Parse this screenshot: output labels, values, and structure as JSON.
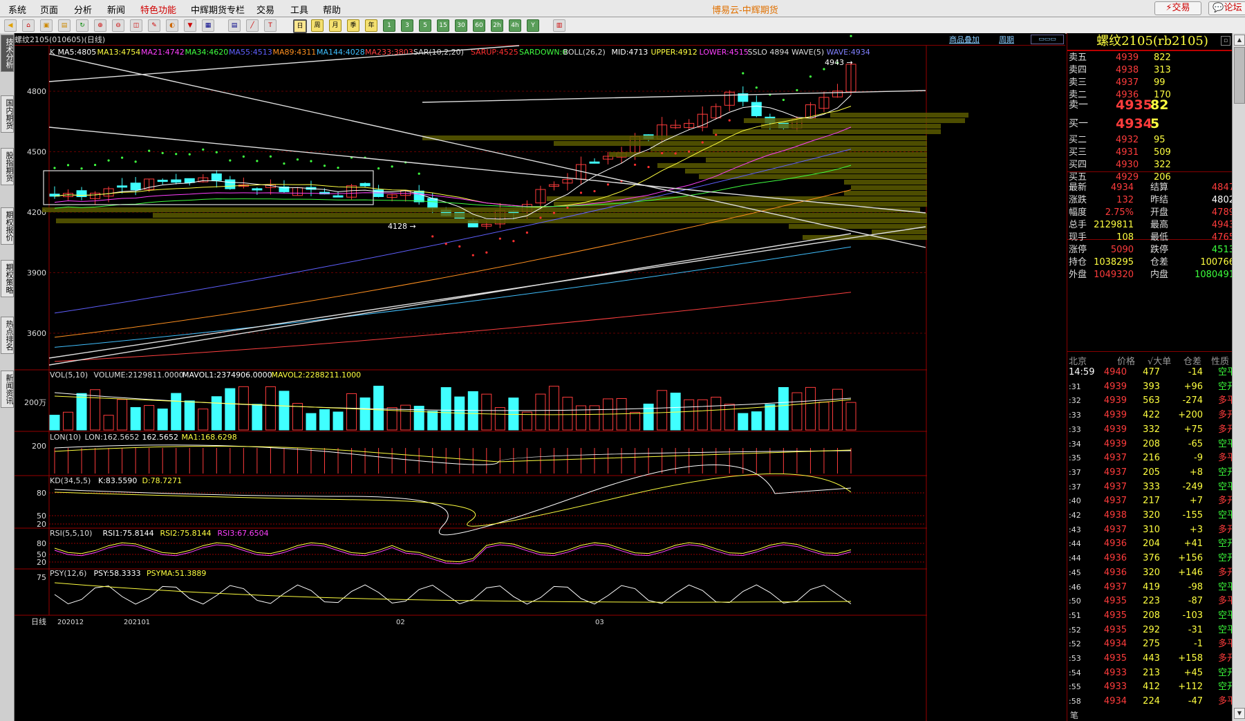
{
  "menu": {
    "items": [
      "系统",
      "页面",
      "分析",
      "新闻",
      "特色功能",
      "中辉期货专栏",
      "交易",
      "工具",
      "帮助"
    ],
    "title": "博易云-中辉期货",
    "trade_btn": "⚡交易",
    "forum_btn": "💬论坛"
  },
  "toolbar": {
    "periods": [
      "日",
      "周",
      "月",
      "季",
      "年"
    ],
    "minutes": [
      "1",
      "3",
      "5",
      "15",
      "30",
      "60",
      "2h",
      "4h",
      "Y"
    ]
  },
  "leftnav": [
    "技术分析",
    "国内期货",
    "股指期货",
    "期权报价",
    "期权策略",
    "热点排名",
    "新闻资讯"
  ],
  "chart": {
    "header_title": "螺纹2105(010605)(日线)",
    "header_link1": "商品叠加",
    "header_link2": "周期",
    "ma_line": [
      {
        "text": "K",
        "color": "#dddddd"
      },
      {
        "text": "MA5:4805",
        "color": "#ffffff"
      },
      {
        "text": "MA13:4754",
        "color": "#ffff40"
      },
      {
        "text": "MA21:4742",
        "color": "#ff40ff"
      },
      {
        "text": "MA34:4620",
        "color": "#40ff40"
      },
      {
        "text": "MA55:4513",
        "color": "#6060ff"
      },
      {
        "text": "MA89:4311",
        "color": "#ff9020"
      },
      {
        "text": "MA144:4028",
        "color": "#40c0ff"
      },
      {
        "text": "MA233:3803",
        "color": "#ff4040"
      },
      {
        "text": "SAR(10,2,20)",
        "color": "#dddddd"
      },
      {
        "text": "SARUP:4525",
        "color": "#ff3030"
      },
      {
        "text": "SARDOWN:0",
        "color": "#40ff40"
      },
      {
        "text": "BOLL(26,2)",
        "color": "#dddddd"
      },
      {
        "text": "MID:4713",
        "color": "#ffffff"
      },
      {
        "text": "UPPER:4912",
        "color": "#ffff40"
      },
      {
        "text": "LOWER:4515",
        "color": "#ff40ff"
      },
      {
        "text": "SSLO 4894",
        "color": "#dddddd"
      },
      {
        "text": "WAVE(5)",
        "color": "#dddddd"
      },
      {
        "text": "WAVE:4934",
        "color": "#8080ff"
      }
    ],
    "price_ticks": [
      "4800",
      "4500",
      "4200",
      "3900",
      "3600"
    ],
    "high_mark": "4943",
    "low_mark": "4128",
    "vol_title": [
      {
        "text": "VOL(5,10)",
        "color": "#dddddd"
      },
      {
        "text": "VOLUME:2129811.0000",
        "color": "#dddddd"
      },
      {
        "text": "MAVOL1:2374906.0000",
        "color": "#ffffff"
      },
      {
        "text": "MAVOL2:2288211.1000",
        "color": "#ffff40"
      }
    ],
    "vol_tick": "200万",
    "lon_title": [
      {
        "text": "LON(10)",
        "color": "#dddddd"
      },
      {
        "text": "LON:162.5652",
        "color": "#dddddd"
      },
      {
        "text": "162.5652",
        "color": "#ffffff"
      },
      {
        "text": "MA1:168.6298",
        "color": "#ffff40"
      }
    ],
    "lon_tick": "200",
    "kd_title": [
      {
        "text": "KD(34,5,5)",
        "color": "#dddddd"
      },
      {
        "text": "K:83.5590",
        "color": "#ffffff"
      },
      {
        "text": "D:78.7271",
        "color": "#ffff40"
      }
    ],
    "kd_ticks": [
      "80",
      "50",
      "20"
    ],
    "rsi_title": [
      {
        "text": "RSI(5,5,10)",
        "color": "#dddddd"
      },
      {
        "text": "RSI1:75.8144",
        "color": "#ffffff"
      },
      {
        "text": "RSI2:75.8144",
        "color": "#ffff40"
      },
      {
        "text": "RSI3:67.6504",
        "color": "#ff40ff"
      }
    ],
    "rsi_ticks": [
      "80",
      "50",
      "20"
    ],
    "psy_title": [
      {
        "text": "PSY(12,6)",
        "color": "#dddddd"
      },
      {
        "text": "PSY:58.3333",
        "color": "#ffffff"
      },
      {
        "text": "PSYMA:51.3889",
        "color": "#ffff40"
      }
    ],
    "psy_tick": "75",
    "date_axis_label": "日线",
    "date_ticks": [
      "202012",
      "202101",
      "02",
      "03"
    ]
  },
  "quote": {
    "title": "螺纹2105(rb2105)",
    "asks": [
      {
        "label": "卖五",
        "price": "4939",
        "vol": "822"
      },
      {
        "label": "卖四",
        "price": "4938",
        "vol": "313"
      },
      {
        "label": "卖三",
        "price": "4937",
        "vol": "99"
      },
      {
        "label": "卖二",
        "price": "4936",
        "vol": "170"
      },
      {
        "label": "卖一",
        "price": "4935",
        "vol": "82"
      }
    ],
    "bids": [
      {
        "label": "买一",
        "price": "4934",
        "vol": "5"
      },
      {
        "label": "买二",
        "price": "4932",
        "vol": "95"
      },
      {
        "label": "买三",
        "price": "4931",
        "vol": "509"
      },
      {
        "label": "买四",
        "price": "4930",
        "vol": "322"
      },
      {
        "label": "买五",
        "price": "4929",
        "vol": "206"
      }
    ],
    "stats": [
      {
        "l1": "最新",
        "v1": "4934",
        "c1": "red",
        "l2": "结算",
        "v2": "4847",
        "c2": "red"
      },
      {
        "l1": "涨跌",
        "v1": "132",
        "c1": "red",
        "l2": "昨结",
        "v2": "4802",
        "c2": "wht"
      },
      {
        "l1": "幅度",
        "v1": "2.75%",
        "c1": "red",
        "l2": "开盘",
        "v2": "4789",
        "c2": "red"
      },
      {
        "l1": "总手",
        "v1": "2129811",
        "c1": "yel",
        "l2": "最高",
        "v2": "4943",
        "c2": "red"
      },
      {
        "l1": "现手",
        "v1": "108",
        "c1": "yel",
        "l2": "最低",
        "v2": "4765",
        "c2": "red"
      },
      {
        "l1": "涨停",
        "v1": "5090",
        "c1": "red",
        "l2": "跌停",
        "v2": "4513",
        "c2": "grn"
      },
      {
        "l1": "持仓",
        "v1": "1038295",
        "c1": "yel",
        "l2": "仓差",
        "v2": "100766",
        "c2": "yel"
      },
      {
        "l1": "外盘",
        "v1": "1049320",
        "c1": "red",
        "l2": "内盘",
        "v2": "1080491",
        "c2": "grn"
      }
    ],
    "tick_header": {
      "time": "北京",
      "price": "价格",
      "vol": "√大单",
      "oi": "仓差",
      "nature": "性质"
    },
    "ticks": [
      {
        "t": "14:59",
        "p": "4940",
        "v": "477",
        "d": "-14",
        "n": "空平",
        "nc": "grn"
      },
      {
        "t": ":31",
        "p": "4939",
        "v": "393",
        "d": "+96",
        "n": "空开",
        "nc": "grn"
      },
      {
        "t": ":32",
        "p": "4939",
        "v": "563",
        "d": "-274",
        "n": "多平",
        "nc": "red"
      },
      {
        "t": ":33",
        "p": "4939",
        "v": "422",
        "d": "+200",
        "n": "多开",
        "nc": "red"
      },
      {
        "t": ":33",
        "p": "4939",
        "v": "332",
        "d": "+75",
        "n": "多开",
        "nc": "red"
      },
      {
        "t": ":34",
        "p": "4939",
        "v": "208",
        "d": "-65",
        "n": "空平",
        "nc": "grn"
      },
      {
        "t": ":35",
        "p": "4937",
        "v": "216",
        "d": "-9",
        "n": "多平",
        "nc": "red"
      },
      {
        "t": ":37",
        "p": "4937",
        "v": "205",
        "d": "+8",
        "n": "空开",
        "nc": "grn"
      },
      {
        "t": ":37",
        "p": "4937",
        "v": "333",
        "d": "-249",
        "n": "空平",
        "nc": "grn"
      },
      {
        "t": ":40",
        "p": "4937",
        "v": "217",
        "d": "+7",
        "n": "多开",
        "nc": "red"
      },
      {
        "t": ":42",
        "p": "4938",
        "v": "320",
        "d": "-155",
        "n": "空平",
        "nc": "grn"
      },
      {
        "t": ":43",
        "p": "4937",
        "v": "310",
        "d": "+3",
        "n": "多开",
        "nc": "red"
      },
      {
        "t": ":44",
        "p": "4936",
        "v": "204",
        "d": "+41",
        "n": "空开",
        "nc": "grn"
      },
      {
        "t": ":44",
        "p": "4936",
        "v": "376",
        "d": "+156",
        "n": "空开",
        "nc": "grn"
      },
      {
        "t": ":45",
        "p": "4936",
        "v": "320",
        "d": "+146",
        "n": "多开",
        "nc": "red"
      },
      {
        "t": ":46",
        "p": "4937",
        "v": "419",
        "d": "-98",
        "n": "空平",
        "nc": "grn"
      },
      {
        "t": ":50",
        "p": "4935",
        "v": "223",
        "d": "-87",
        "n": "多平",
        "nc": "red"
      },
      {
        "t": ":51",
        "p": "4935",
        "v": "208",
        "d": "-103",
        "n": "空平",
        "nc": "grn"
      },
      {
        "t": ":52",
        "p": "4935",
        "v": "292",
        "d": "-31",
        "n": "空平",
        "nc": "grn"
      },
      {
        "t": ":52",
        "p": "4934",
        "v": "275",
        "d": "-1",
        "n": "多平",
        "nc": "red"
      },
      {
        "t": ":53",
        "p": "4935",
        "v": "443",
        "d": "+158",
        "n": "多开",
        "nc": "red"
      },
      {
        "t": ":54",
        "p": "4933",
        "v": "213",
        "d": "+45",
        "n": "空开",
        "nc": "grn"
      },
      {
        "t": ":55",
        "p": "4933",
        "v": "412",
        "d": "+112",
        "n": "空开",
        "nc": "grn"
      },
      {
        "t": ":58",
        "p": "4934",
        "v": "224",
        "d": "-47",
        "n": "多平",
        "nc": "red"
      }
    ],
    "footer": "笔"
  }
}
